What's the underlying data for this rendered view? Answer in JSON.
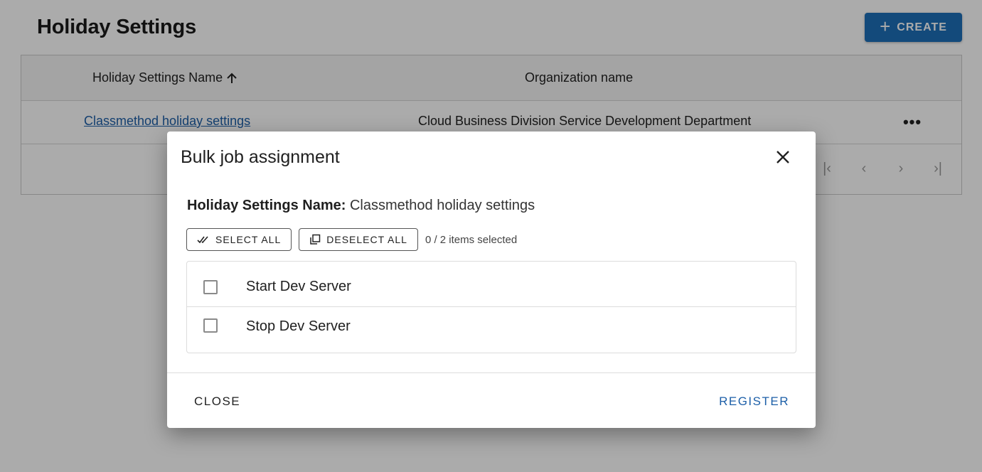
{
  "page": {
    "title": "Holiday Settings",
    "create_label": "CREATE"
  },
  "table": {
    "columns": [
      "Holiday Settings Name",
      "Organization name"
    ],
    "rows": [
      {
        "name": "Classmethod holiday settings",
        "organization": "Cloud Business Division Service Development Department"
      }
    ],
    "more_label": "•••"
  },
  "dialog": {
    "title": "Bulk job assignment",
    "settings_name_label": "Holiday Settings Name:",
    "settings_name_value": "Classmethod holiday settings",
    "select_all_label": "SELECT ALL",
    "deselect_all_label": "DESELECT ALL",
    "selection_count": "0 / 2 items selected",
    "jobs": [
      {
        "label": "Start Dev Server",
        "checked": false
      },
      {
        "label": "Stop Dev Server",
        "checked": false
      }
    ],
    "close_label": "CLOSE",
    "register_label": "REGISTER"
  },
  "colors": {
    "accent": "#1d6fb8",
    "link": "#1d5fa8",
    "overlay": "rgba(0,0,0,0.33)"
  }
}
